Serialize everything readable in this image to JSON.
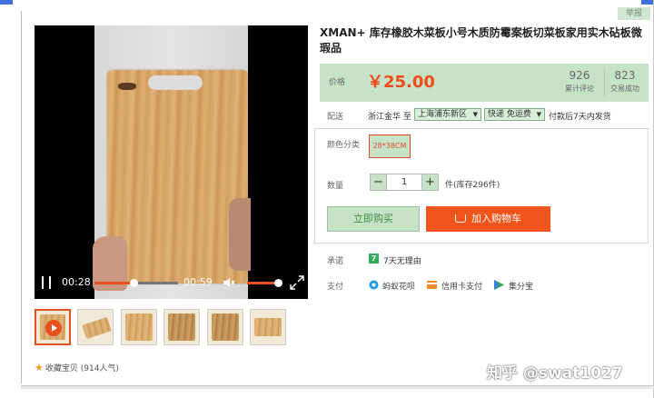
{
  "report": "举报",
  "product": {
    "title": "XMAN+ 库存橡胶木菜板小号木质防霉案板切菜板家用实木砧板微瑕品"
  },
  "price": {
    "label": "价格",
    "value": "￥25.00",
    "reviews_count": "926",
    "reviews_label": "累计评论",
    "sales_count": "823",
    "sales_label": "交易成功"
  },
  "shipping": {
    "label": "配送",
    "from": "浙江金华 至",
    "to_select": "上海浦东新区",
    "method_select": "快递 免运费",
    "note": "付款后7天内发货"
  },
  "options": {
    "color_label": "颜色分类",
    "color_value": "28*38CM",
    "qty_label": "数量",
    "qty_minus": "−",
    "qty_value": "1",
    "qty_plus": "+",
    "stock": "件(库存296件)"
  },
  "actions": {
    "buy_now": "立即购买",
    "add_to_cart": "加入购物车"
  },
  "promise": {
    "label": "承诺",
    "badge": "7",
    "text": "7天无理由"
  },
  "payment": {
    "label": "支付",
    "methods": [
      "蚂蚁花呗",
      "信用卡支付",
      "集分宝"
    ]
  },
  "video": {
    "current_time": "00:28",
    "total_time": "00:59",
    "progress": 0.47,
    "volume": 1.0
  },
  "favorite": {
    "text": "收藏宝贝 (914人气)"
  },
  "watermark": "知乎 @swat1027",
  "colors": {
    "accent_green": "#c6e3c8",
    "price_red": "#f24a18",
    "cart_orange": "#f2541b"
  }
}
